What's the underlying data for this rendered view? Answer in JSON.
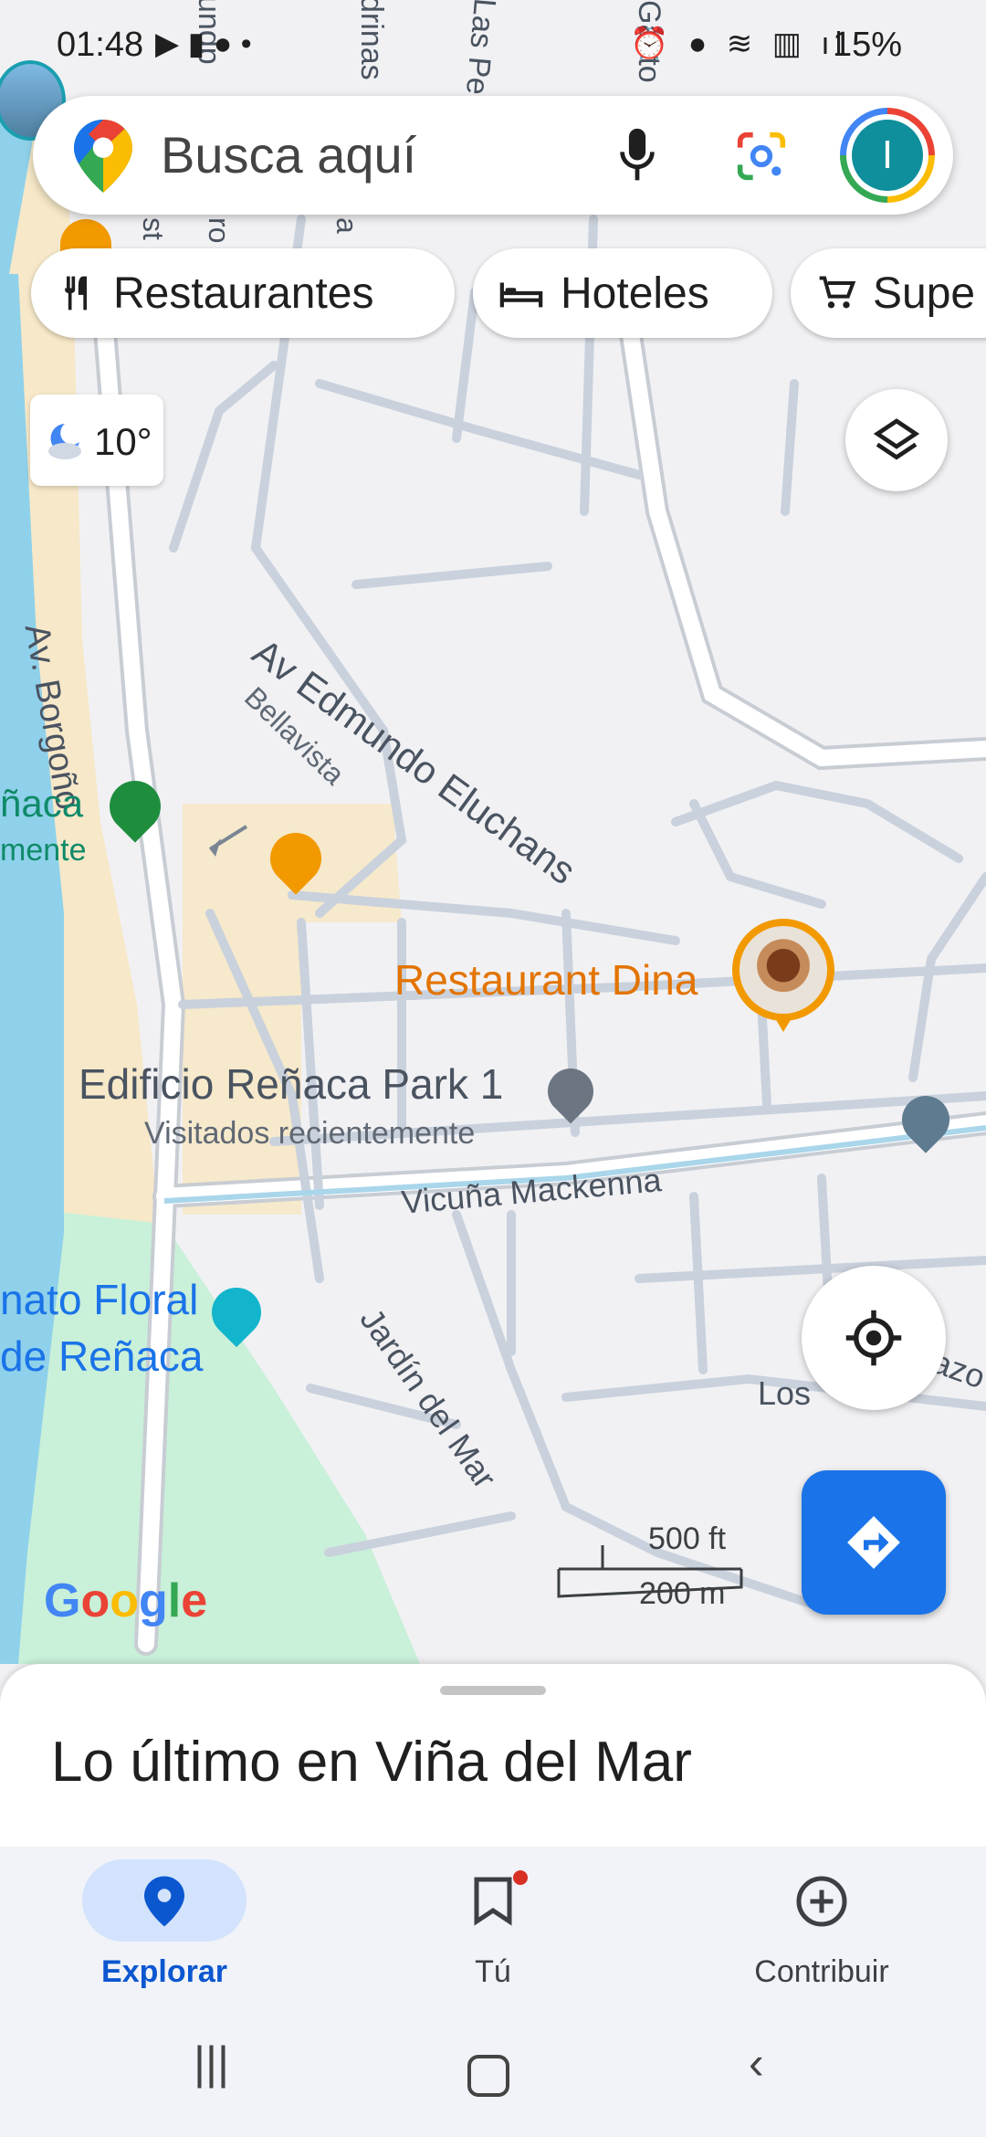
{
  "status_bar": {
    "time": "01:48",
    "battery": "15%"
  },
  "search": {
    "placeholder": "Busca aquí"
  },
  "account": {
    "initial": "I"
  },
  "chips": [
    {
      "label": "Restaurantes",
      "icon": "fork-knife-icon"
    },
    {
      "label": "Hoteles",
      "icon": "bed-icon"
    },
    {
      "label": "Supe",
      "icon": "cart-icon"
    }
  ],
  "weather": {
    "temp": "10°",
    "icon": "moon-cloud-icon"
  },
  "map": {
    "streets": {
      "av_borgono": "Av. Borgoño",
      "av_edmundo": "Av Edmundo Eluchans",
      "bellavista": "Bellavista",
      "vicuna": "Vicuña Mackenna",
      "jardin": "Jardín del Mar",
      "los": "Los",
      "azo": "azo",
      "top1": "undp",
      "top2": "drinas",
      "top3": "Las Pe",
      "top4": "Gasto",
      "left1": "st",
      "left2": "ro",
      "left3": "a"
    },
    "places": {
      "beach_a": "ñaca",
      "beach_b": "mente",
      "restaurant": "Restaurant Dina",
      "edificio": "Edificio Reñaca Park 1",
      "edificio_sub": "Visitados recientemente",
      "floral_a": "nato Floral",
      "floral_b": "de Reñaca"
    },
    "scale": {
      "ft": "500 ft",
      "m": "200 m"
    },
    "logo": "Google"
  },
  "sheet": {
    "title": "Lo último en Viña del Mar"
  },
  "bottom_nav": [
    {
      "label": "Explorar",
      "active": true,
      "icon": "pin-icon"
    },
    {
      "label": "Tú",
      "active": false,
      "icon": "bookmark-icon"
    },
    {
      "label": "Contribuir",
      "active": false,
      "icon": "plus-circle-icon"
    }
  ],
  "colors": {
    "accent": "#1a73e8",
    "restaurant": "#e37400",
    "water": "#8fd1ea",
    "sand": "#f6e8c8",
    "park": "#c9f0d9",
    "road": "#ffffff",
    "school": "#5f7b8f"
  }
}
